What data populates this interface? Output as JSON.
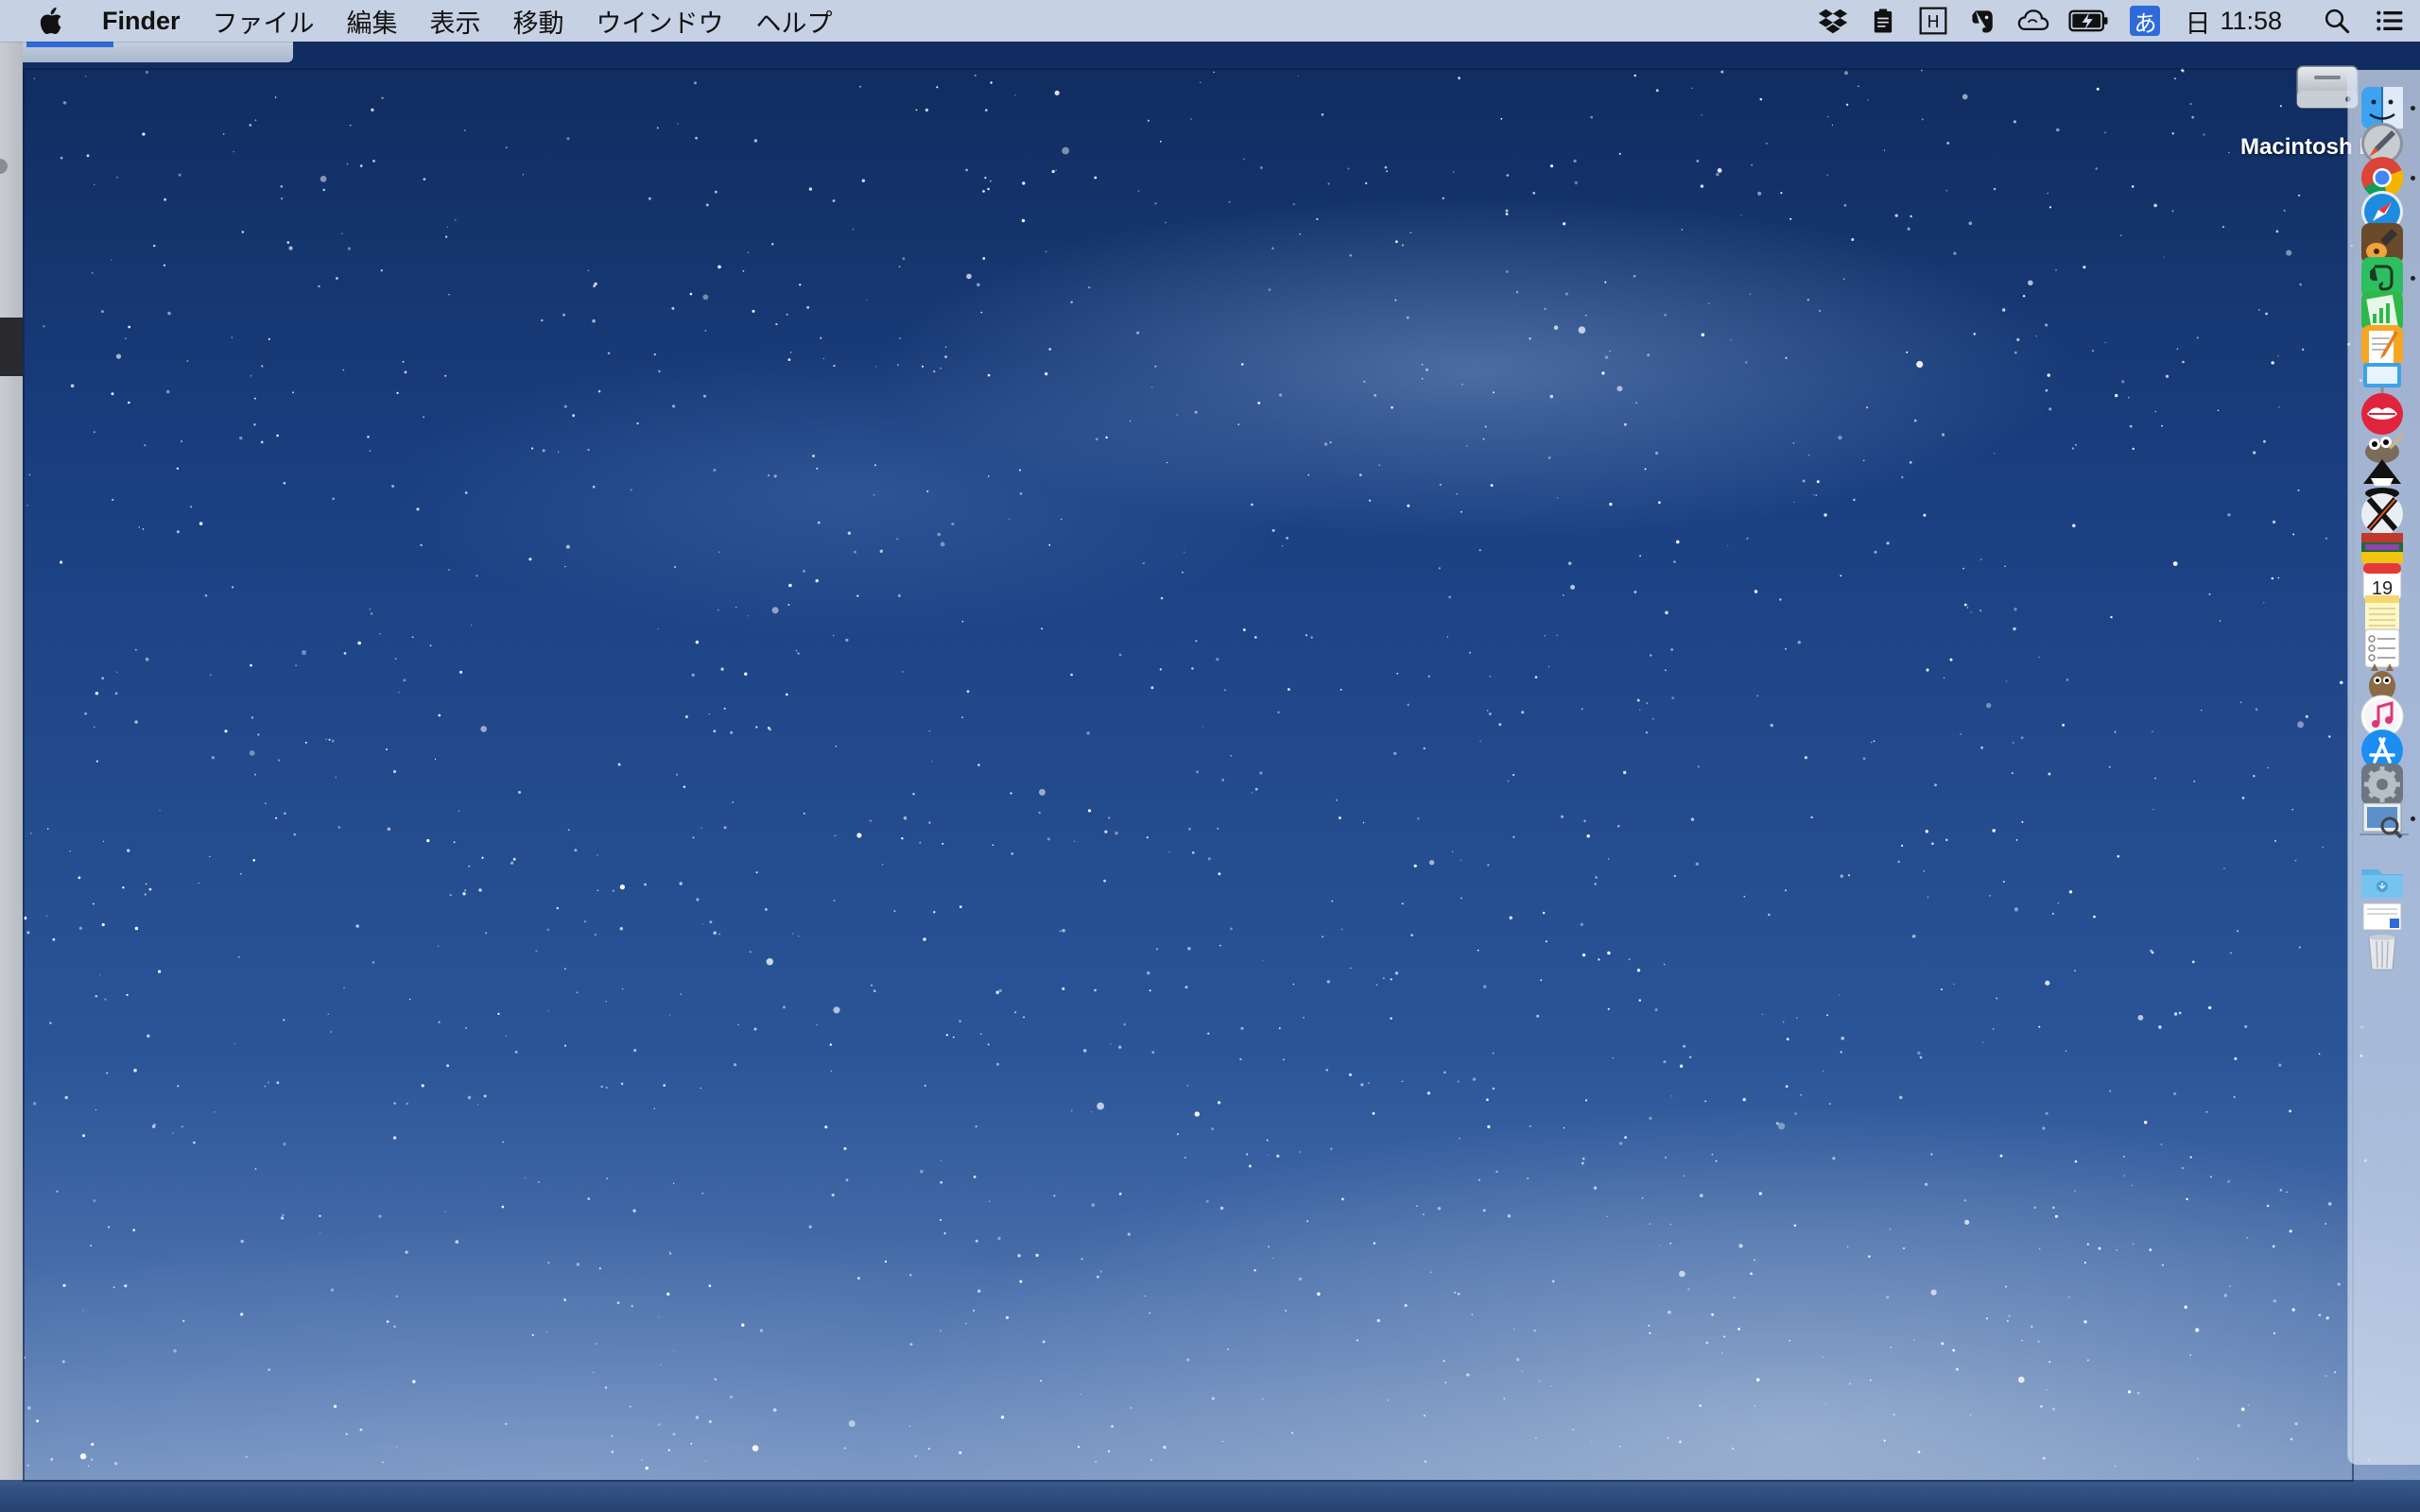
{
  "menubar": {
    "apple_icon": "apple-icon",
    "app_name": "Finder",
    "items": [
      "ファイル",
      "編集",
      "表示",
      "移動",
      "ウインドウ",
      "ヘルプ"
    ],
    "status_icons": [
      "dropbox-icon",
      "clipboard-icon",
      "kanji-icon",
      "evernote-icon",
      "cloud-sync-icon",
      "battery-icon",
      "input-method-icon"
    ],
    "input_method_label": "あ",
    "kanji_label": "H",
    "date_day": "日",
    "time": "11:58",
    "spotlight_icon": "search-icon",
    "notification_icon": "list-icon"
  },
  "desktop": {
    "drive_label": "Macintosh HD",
    "drive_icon": "hard-drive-icon"
  },
  "dock": {
    "items": [
      {
        "name": "finder",
        "icon": "finder-icon",
        "running": true
      },
      {
        "name": "launchpad",
        "icon": "rocket-icon",
        "running": false
      },
      {
        "name": "chrome",
        "icon": "chrome-icon",
        "running": true
      },
      {
        "name": "safari",
        "icon": "safari-icon",
        "running": false
      },
      {
        "name": "garageband",
        "icon": "guitar-icon",
        "running": false
      },
      {
        "name": "evernote",
        "icon": "evernote-icon",
        "running": true
      },
      {
        "name": "numbers",
        "icon": "numbers-icon",
        "running": false
      },
      {
        "name": "pages",
        "icon": "pages-icon",
        "running": false
      },
      {
        "name": "keynote",
        "icon": "keynote-icon",
        "running": false
      },
      {
        "name": "kiss-app",
        "icon": "lips-icon",
        "running": false
      },
      {
        "name": "gimp",
        "icon": "gimp-icon",
        "running": false
      },
      {
        "name": "inkscape",
        "icon": "inkscape-icon",
        "running": false
      },
      {
        "name": "x11",
        "icon": "x-icon",
        "running": false
      },
      {
        "name": "screen-app",
        "icon": "photo-icon",
        "running": false
      },
      {
        "name": "calendar",
        "icon": "calendar-icon",
        "running": false,
        "label": "19"
      },
      {
        "name": "notes",
        "icon": "notes-icon",
        "running": false
      },
      {
        "name": "reminders",
        "icon": "reminders-icon",
        "running": false
      },
      {
        "name": "automator",
        "icon": "automator-icon",
        "running": false
      },
      {
        "name": "itunes",
        "icon": "music-icon",
        "running": false
      },
      {
        "name": "app-store",
        "icon": "app-store-icon",
        "running": false
      },
      {
        "name": "system-preferences",
        "icon": "gear-icon",
        "running": false
      },
      {
        "name": "preview",
        "icon": "preview-icon",
        "running": true
      },
      {
        "name": "downloads",
        "icon": "folder-icon",
        "running": false
      },
      {
        "name": "document",
        "icon": "document-icon",
        "running": false
      },
      {
        "name": "trash",
        "icon": "trash-icon",
        "running": false
      }
    ]
  }
}
